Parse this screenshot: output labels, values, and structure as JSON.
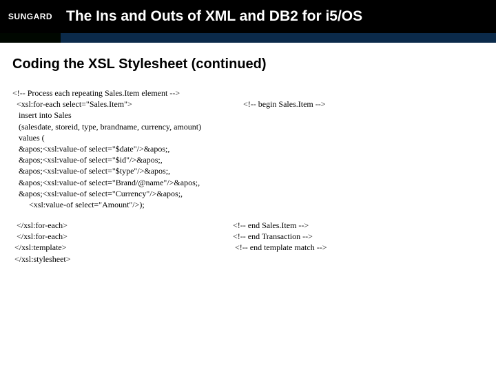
{
  "header": {
    "logo": "SUNGARD",
    "title": "The Ins and Outs of XML and DB2 for i5/OS"
  },
  "section_title": "Coding the XSL Stylesheet (continued)",
  "code": {
    "c_top": "<!-- Process each repeating Sales.Item element -->",
    "foreach_left": "  <xsl:for-each select=\"Sales.Item\">",
    "foreach_right": "<!-- begin Sales.Item -->",
    "l_insert": "   insert into Sales",
    "l_cols": "   (salesdate, storeid, type, brandname, currency, amount)",
    "l_values": "   values (",
    "l_date": "   &apos;<xsl:value-of select=\"$date\"/>&apos;,",
    "l_id": "   &apos;<xsl:value-of select=\"$id\"/>&apos;,",
    "l_type": "   &apos;<xsl:value-of select=\"$type\"/>&apos;,",
    "l_brand": "   &apos;<xsl:value-of select=\"Brand/@name\"/>&apos;,",
    "l_curr": "   &apos;<xsl:value-of select=\"Currency\"/>&apos;,",
    "l_amount": "        <xsl:value-of select=\"Amount\"/>);",
    "end1_l": "  </xsl:for-each>",
    "end1_r": "<!-- end Sales.Item -->",
    "end2_l": "  </xsl:for-each>",
    "end2_r": "<!-- end Transaction -->",
    "end3_l": " </xsl:template>",
    "end3_r": " <!-- end template match -->",
    "end4_l": " </xsl:stylesheet>"
  }
}
